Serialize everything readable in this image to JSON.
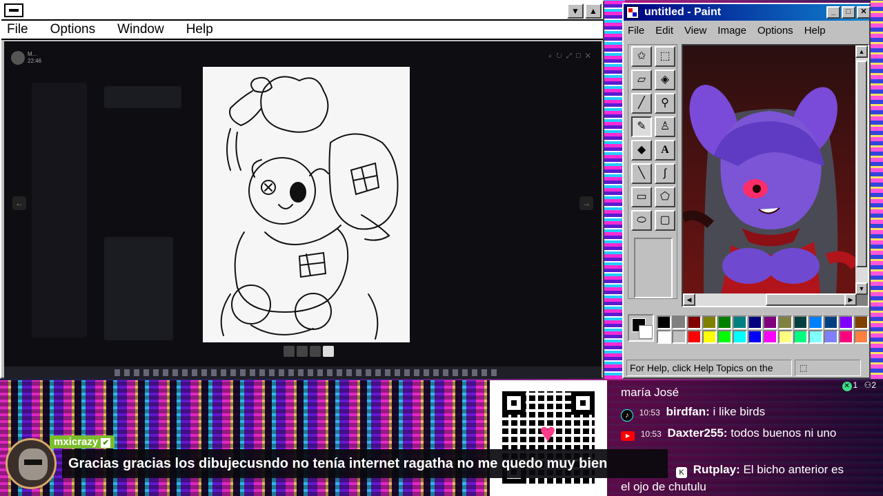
{
  "main_window": {
    "menu": [
      "File",
      "Options",
      "Window",
      "Help"
    ],
    "viewer_user": "M...",
    "viewer_time": "22:46"
  },
  "paint": {
    "title": "untitled - Paint",
    "menu": [
      "File",
      "Edit",
      "View",
      "Image",
      "Options",
      "Help"
    ],
    "status": "For Help, click Help Topics on the",
    "tools": [
      "free-select-icon",
      "rect-select-icon",
      "eraser-icon",
      "fill-icon",
      "color-picker-icon",
      "magnifier-icon",
      "pencil-icon",
      "brush-icon",
      "airbrush-icon",
      "text-icon",
      "line-icon",
      "curve-icon",
      "rectangle-icon",
      "polygon-icon",
      "ellipse-icon",
      "rounded-rect-icon"
    ],
    "palette_top": [
      "#000000",
      "#808080",
      "#800000",
      "#808000",
      "#008000",
      "#008080",
      "#000080",
      "#800080",
      "#808040",
      "#004040",
      "#0080ff",
      "#004080",
      "#8000ff",
      "#804000"
    ],
    "palette_bottom": [
      "#ffffff",
      "#c0c0c0",
      "#ff0000",
      "#ffff00",
      "#00ff00",
      "#00ffff",
      "#0000ff",
      "#ff00ff",
      "#ffff80",
      "#00ff80",
      "#80ffff",
      "#8080ff",
      "#ff0080",
      "#ff8040"
    ]
  },
  "subtitle": {
    "name": "mxicrazy",
    "message": "Gracias gracias los dibujecusndo no tenía internet ragatha no me quedo muy bien"
  },
  "chat": {
    "badges": {
      "x_count": "1",
      "other_count": "2"
    },
    "lines": [
      {
        "time": "",
        "name": "",
        "text": "maría José",
        "platform": "none"
      },
      {
        "time": "10:53",
        "name": "birdfan:",
        "text": "i like birds",
        "platform": "tiktok"
      },
      {
        "time": "10:53",
        "name": "Daxter255:",
        "text": "todos buenos ni uno",
        "platform": "youtube"
      },
      {
        "time": "",
        "name": "Rutplay:",
        "text": "El bicho anterior es",
        "platform": "kick"
      },
      {
        "time": "",
        "name": "",
        "text": "el ojo de chutulu",
        "platform": "none"
      }
    ]
  }
}
